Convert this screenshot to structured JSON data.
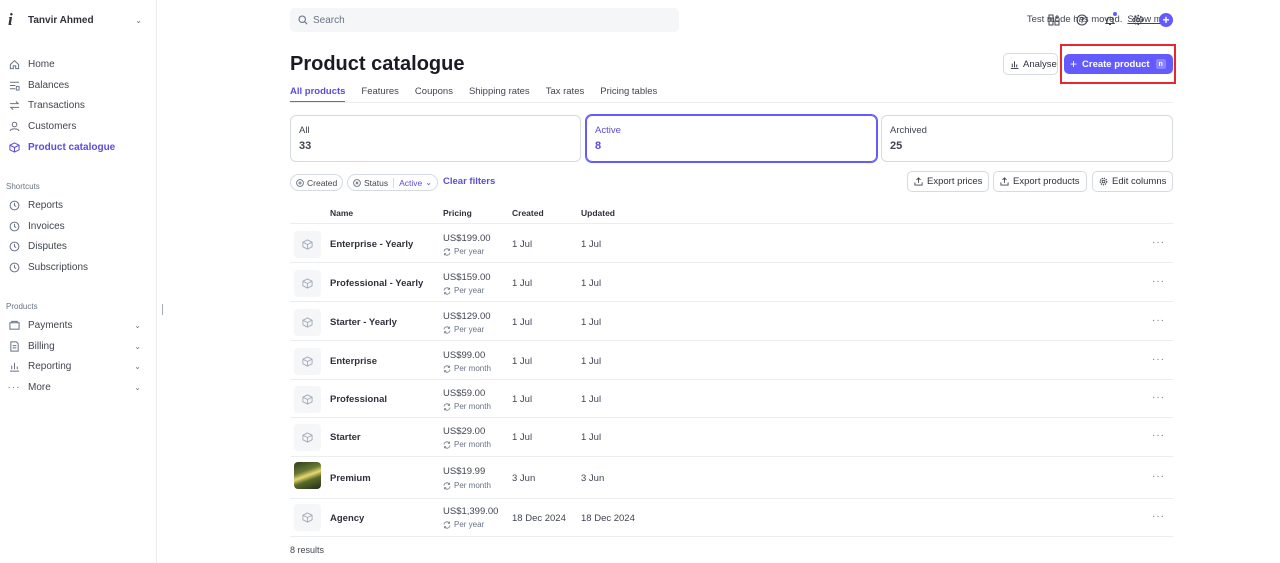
{
  "account": {
    "name": "Tanvir Ahmed",
    "logo_letter": "i"
  },
  "nav": {
    "main": [
      {
        "label": "Home",
        "icon": "home-icon"
      },
      {
        "label": "Balances",
        "icon": "balances-icon"
      },
      {
        "label": "Transactions",
        "icon": "transactions-icon"
      },
      {
        "label": "Customers",
        "icon": "customers-icon"
      },
      {
        "label": "Product catalogue",
        "icon": "product-catalogue-icon",
        "active": true
      }
    ],
    "shortcuts_title": "Shortcuts",
    "shortcuts": [
      {
        "label": "Reports",
        "icon": "clock-icon"
      },
      {
        "label": "Invoices",
        "icon": "clock-icon"
      },
      {
        "label": "Disputes",
        "icon": "clock-icon"
      },
      {
        "label": "Subscriptions",
        "icon": "clock-icon"
      }
    ],
    "products_title": "Products",
    "products": [
      {
        "label": "Payments",
        "icon": "payments-icon"
      },
      {
        "label": "Billing",
        "icon": "billing-icon"
      },
      {
        "label": "Reporting",
        "icon": "reporting-icon"
      },
      {
        "label": "More",
        "icon": "more-dots-icon"
      }
    ]
  },
  "header": {
    "search_placeholder": "Search",
    "test_mode_text": "Test mode has moved.",
    "show_me": "Show me"
  },
  "page": {
    "title": "Product catalogue",
    "analyse_label": "Analyse",
    "create_label": "Create product",
    "create_shortcut": "n"
  },
  "tabs": [
    "All products",
    "Features",
    "Coupons",
    "Shipping rates",
    "Tax rates",
    "Pricing tables"
  ],
  "status_cards": [
    {
      "label": "All",
      "count": "33"
    },
    {
      "label": "Active",
      "count": "8"
    },
    {
      "label": "Archived",
      "count": "25"
    }
  ],
  "filters": {
    "created": "Created",
    "status": "Status",
    "status_value": "Active",
    "clear": "Clear filters"
  },
  "actions": {
    "export_prices": "Export prices",
    "export_products": "Export products",
    "edit_columns": "Edit columns"
  },
  "table": {
    "columns": {
      "name": "Name",
      "pricing": "Pricing",
      "created": "Created",
      "updated": "Updated"
    },
    "rows": [
      {
        "name": "Enterprise - Yearly",
        "price": "US$199.00",
        "period": "Per year",
        "created": "1 Jul",
        "updated": "1 Jul"
      },
      {
        "name": "Professional - Yearly",
        "price": "US$159.00",
        "period": "Per year",
        "created": "1 Jul",
        "updated": "1 Jul"
      },
      {
        "name": "Starter - Yearly",
        "price": "US$129.00",
        "period": "Per year",
        "created": "1 Jul",
        "updated": "1 Jul"
      },
      {
        "name": "Enterprise",
        "price": "US$99.00",
        "period": "Per month",
        "created": "1 Jul",
        "updated": "1 Jul"
      },
      {
        "name": "Professional",
        "price": "US$59.00",
        "period": "Per month",
        "created": "1 Jul",
        "updated": "1 Jul"
      },
      {
        "name": "Starter",
        "price": "US$29.00",
        "period": "Per month",
        "created": "1 Jul",
        "updated": "1 Jul"
      },
      {
        "name": "Premium",
        "price": "US$19.99",
        "period": "Per month",
        "created": "3 Jun",
        "updated": "3 Jun"
      },
      {
        "name": "Agency",
        "price": "US$1,399.00",
        "period": "Per year",
        "created": "18 Dec 2024",
        "updated": "18 Dec 2024"
      }
    ],
    "results": "8 results"
  },
  "colors": {
    "accent": "#635bff",
    "highlight": "#e5282c"
  }
}
